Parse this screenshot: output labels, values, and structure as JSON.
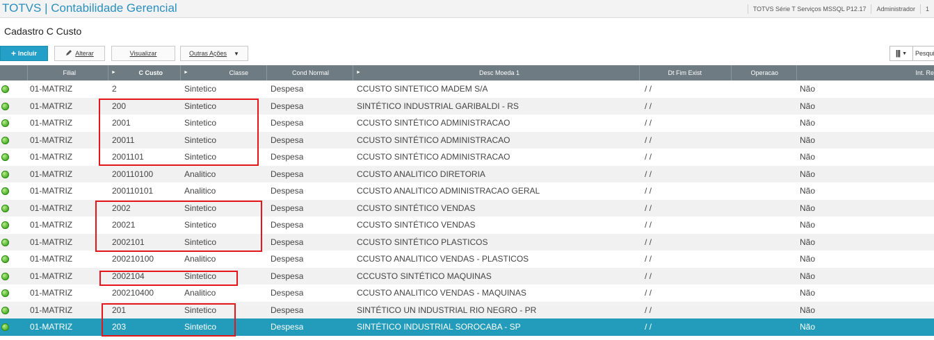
{
  "app": {
    "title": "TOTVS | Contabilidade Gerencial"
  },
  "topbar": {
    "environment": "TOTVS Série T Serviços MSSQL P12.17",
    "user": "Administrador",
    "extra": "1"
  },
  "page": {
    "title": "Cadastro C Custo"
  },
  "toolbar": {
    "incluir": "Incluir",
    "alterar": "Alterar",
    "visualizar": "Visualizar",
    "outras": "Outras Ações",
    "search_placeholder": "Pesquisar"
  },
  "grid": {
    "columns": [
      "Filial",
      "C Custo",
      "Classe",
      "Cond Normal",
      "Desc Moeda 1",
      "Dt Fim Exist",
      "Operacao",
      "Int. Re"
    ],
    "rows": [
      {
        "filial": "01-MATRIZ",
        "ccusto": "2",
        "classe": "Sintetico",
        "cond": "Despesa",
        "desc": "CCUSTO SINTETICO MADEM S/A",
        "dtfim": "/ /",
        "int": "Não"
      },
      {
        "filial": "01-MATRIZ",
        "ccusto": "200",
        "classe": "Sintetico",
        "cond": "Despesa",
        "desc": "SINTÉTICO INDUSTRIAL GARIBALDI - RS",
        "dtfim": "/ /",
        "int": "Não"
      },
      {
        "filial": "01-MATRIZ",
        "ccusto": "2001",
        "classe": "Sintetico",
        "cond": "Despesa",
        "desc": "CCUSTO SINTÉTICO ADMINISTRACAO",
        "dtfim": "/ /",
        "int": "Não"
      },
      {
        "filial": "01-MATRIZ",
        "ccusto": "20011",
        "classe": "Sintetico",
        "cond": "Despesa",
        "desc": "CCUSTO SINTÉTICO ADMINISTRACAO",
        "dtfim": "/ /",
        "int": "Não"
      },
      {
        "filial": "01-MATRIZ",
        "ccusto": "2001101",
        "classe": "Sintetico",
        "cond": "Despesa",
        "desc": "CCUSTO SINTÉTICO ADMINISTRACAO",
        "dtfim": "/ /",
        "int": "Não"
      },
      {
        "filial": "01-MATRIZ",
        "ccusto": "200110100",
        "classe": "Analitico",
        "cond": "Despesa",
        "desc": "CCUSTO ANALITICO DIRETORIA",
        "dtfim": "/ /",
        "int": "Não"
      },
      {
        "filial": "01-MATRIZ",
        "ccusto": "200110101",
        "classe": "Analitico",
        "cond": "Despesa",
        "desc": "CCUSTO ANALITICO  ADMINISTRACAO GERAL",
        "dtfim": "/ /",
        "int": "Não"
      },
      {
        "filial": "01-MATRIZ",
        "ccusto": "2002",
        "classe": "Sintetico",
        "cond": "Despesa",
        "desc": "CCUSTO SINTÉTICO VENDAS",
        "dtfim": "/ /",
        "int": "Não"
      },
      {
        "filial": "01-MATRIZ",
        "ccusto": "20021",
        "classe": "Sintetico",
        "cond": "Despesa",
        "desc": "CCUSTO SINTÉTICO VENDAS",
        "dtfim": "/ /",
        "int": "Não"
      },
      {
        "filial": "01-MATRIZ",
        "ccusto": "2002101",
        "classe": "Sintetico",
        "cond": "Despesa",
        "desc": "CCUSTO SINTÉTICO PLASTICOS",
        "dtfim": "/ /",
        "int": "Não"
      },
      {
        "filial": "01-MATRIZ",
        "ccusto": "200210100",
        "classe": "Analitico",
        "cond": "Despesa",
        "desc": "CCUSTO ANALITICO VENDAS - PLASTICOS",
        "dtfim": "/ /",
        "int": "Não"
      },
      {
        "filial": "01-MATRIZ",
        "ccusto": "2002104",
        "classe": "Sintetico",
        "cond": "Despesa",
        "desc": "CCCUSTO SINTÉTICO MAQUINAS",
        "dtfim": "/ /",
        "int": "Não"
      },
      {
        "filial": "01-MATRIZ",
        "ccusto": "200210400",
        "classe": "Analitico",
        "cond": "Despesa",
        "desc": "CCUSTO ANALITICO VENDAS - MAQUINAS",
        "dtfim": "/ /",
        "int": "Não"
      },
      {
        "filial": "01-MATRIZ",
        "ccusto": "201",
        "classe": "Sintetico",
        "cond": "Despesa",
        "desc": "SINTÉTICO UN INDUSTRIAL RIO NEGRO - PR",
        "dtfim": "/ /",
        "int": "Não"
      },
      {
        "filial": "01-MATRIZ",
        "ccusto": "203",
        "classe": "Sintetico",
        "cond": "Despesa",
        "desc": "SINTÉTICO INDUSTRIAL SOROCABA - SP",
        "dtfim": "/ /",
        "int": "Não"
      }
    ]
  },
  "colors": {
    "accent": "#24a0c8",
    "header_bg": "#6e7b82",
    "selected_row": "#229cba",
    "highlight_box": "#e5151b",
    "status_green": "#3fa820"
  }
}
